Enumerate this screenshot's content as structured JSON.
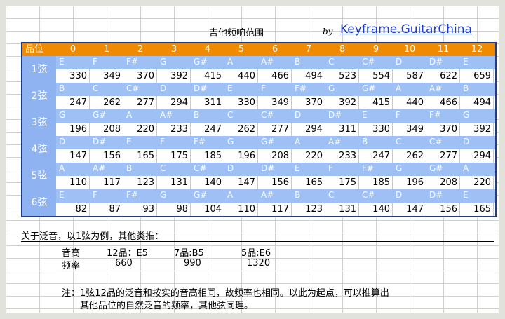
{
  "title": "吉他频响范围",
  "by": "by",
  "link": "Keyframe.GuitarChina",
  "header": {
    "label": "品位",
    "frets": [
      "0",
      "1",
      "2",
      "3",
      "4",
      "5",
      "6",
      "7",
      "8",
      "9",
      "10",
      "11",
      "12"
    ]
  },
  "strings": [
    {
      "label": "1弦",
      "notes": [
        "E",
        "F",
        "F#",
        "G",
        "G#",
        "A",
        "A#",
        "B",
        "C",
        "C#",
        "D",
        "D#",
        "E"
      ],
      "freqs": [
        "330",
        "349",
        "370",
        "392",
        "415",
        "440",
        "466",
        "494",
        "523",
        "554",
        "587",
        "622",
        "659"
      ]
    },
    {
      "label": "2弦",
      "notes": [
        "B",
        "C",
        "C#",
        "D",
        "D#",
        "E",
        "F",
        "F#",
        "G",
        "G#",
        "A",
        "A#",
        "B"
      ],
      "freqs": [
        "247",
        "262",
        "277",
        "294",
        "311",
        "330",
        "349",
        "370",
        "392",
        "415",
        "440",
        "466",
        "494"
      ]
    },
    {
      "label": "3弦",
      "notes": [
        "G",
        "G#",
        "A",
        "A#",
        "B",
        "C",
        "C#",
        "D",
        "D#",
        "E",
        "F",
        "F#",
        "G"
      ],
      "freqs": [
        "196",
        "208",
        "220",
        "233",
        "247",
        "262",
        "277",
        "294",
        "311",
        "330",
        "349",
        "370",
        "392"
      ]
    },
    {
      "label": "4弦",
      "notes": [
        "D",
        "D#",
        "E",
        "F",
        "F#",
        "G",
        "G#",
        "A",
        "A#",
        "B",
        "C",
        "C#",
        "D"
      ],
      "freqs": [
        "147",
        "156",
        "165",
        "175",
        "185",
        "196",
        "208",
        "220",
        "233",
        "247",
        "262",
        "277",
        "294"
      ]
    },
    {
      "label": "5弦",
      "notes": [
        "A",
        "A#",
        "B",
        "C",
        "C#",
        "D",
        "D#",
        "E",
        "F",
        "F#",
        "G",
        "G#",
        "A"
      ],
      "freqs": [
        "110",
        "117",
        "123",
        "131",
        "140",
        "147",
        "156",
        "165",
        "175",
        "185",
        "196",
        "208",
        "220"
      ]
    },
    {
      "label": "6弦",
      "notes": [
        "E",
        "F",
        "F#",
        "G",
        "G#",
        "A",
        "A#",
        "B",
        "C",
        "C#",
        "D",
        "D#",
        "E"
      ],
      "freqs": [
        "82",
        "87",
        "93",
        "98",
        "104",
        "110",
        "117",
        "123",
        "131",
        "140",
        "147",
        "156",
        "165"
      ]
    }
  ],
  "harmonics": {
    "intro": "关于泛音，以1弦为例，其他类推：",
    "pitch_label": "音高",
    "freq_label": "频率",
    "pitches": [
      "12品：E5",
      "7品:B5",
      "5品:E6"
    ],
    "freqs": [
      "660",
      "990",
      "1320"
    ]
  },
  "note_line1": "注：1弦12品的泛音和按实的音高相同，故频率也相同。以此为起点，可以推算出",
  "note_line2": "其他品位的自然泛音的频率，其他弦同理。"
}
